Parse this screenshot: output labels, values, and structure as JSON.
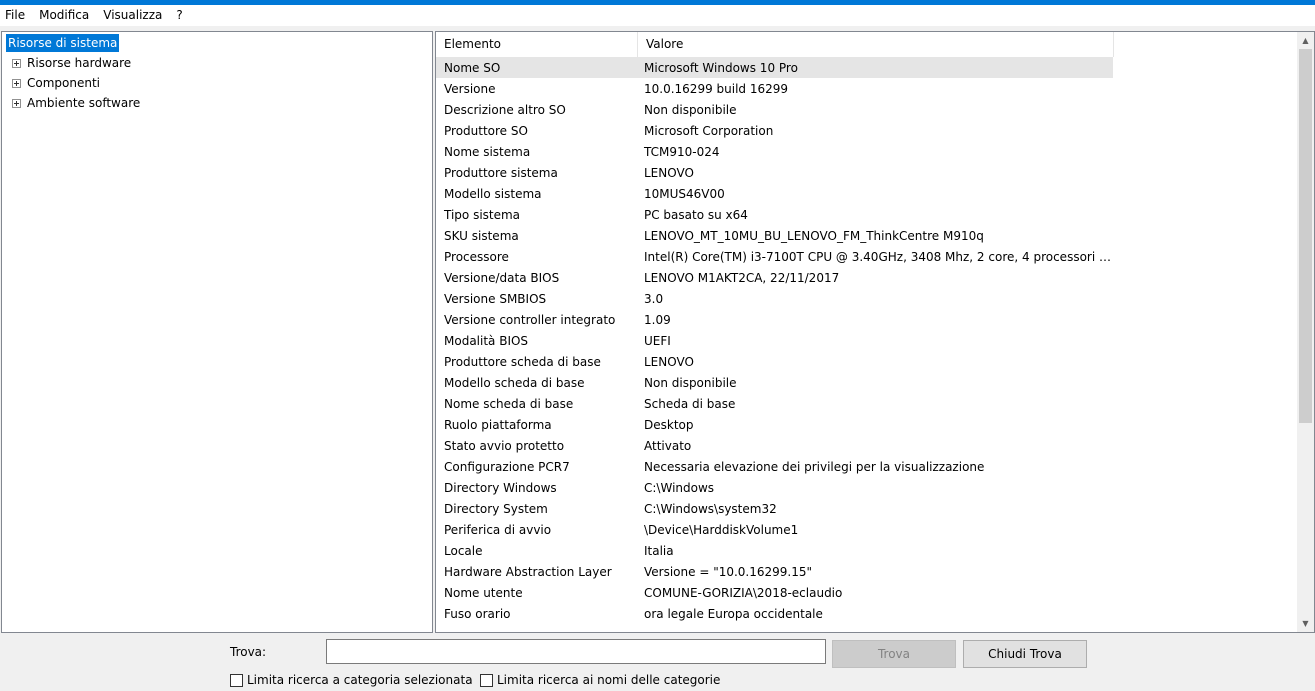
{
  "menu": [
    "File",
    "Modifica",
    "Visualizza",
    "?"
  ],
  "tree": {
    "root": "Risorse di sistema",
    "children": [
      "Risorse hardware",
      "Componenti",
      "Ambiente software"
    ]
  },
  "table": {
    "headers": [
      "Elemento",
      "Valore"
    ],
    "rows": [
      [
        "Nome SO",
        "Microsoft Windows 10 Pro"
      ],
      [
        "Versione",
        "10.0.16299 build 16299"
      ],
      [
        "Descrizione altro SO",
        "Non disponibile"
      ],
      [
        "Produttore SO",
        "Microsoft Corporation"
      ],
      [
        "Nome sistema",
        "TCM910-024"
      ],
      [
        "Produttore sistema",
        "LENOVO"
      ],
      [
        "Modello sistema",
        "10MUS46V00"
      ],
      [
        "Tipo sistema",
        "PC basato su x64"
      ],
      [
        "SKU sistema",
        "LENOVO_MT_10MU_BU_LENOVO_FM_ThinkCentre M910q"
      ],
      [
        "Processore",
        "Intel(R) Core(TM) i3-7100T CPU @ 3.40GHz, 3408 Mhz, 2 core, 4 processori lo..."
      ],
      [
        "Versione/data BIOS",
        "LENOVO M1AKT2CA, 22/11/2017"
      ],
      [
        "Versione SMBIOS",
        "3.0"
      ],
      [
        "Versione controller integrato",
        "1.09"
      ],
      [
        "Modalità BIOS",
        "UEFI"
      ],
      [
        "Produttore scheda di base",
        "LENOVO"
      ],
      [
        "Modello scheda di base",
        "Non disponibile"
      ],
      [
        "Nome scheda di base",
        "Scheda di base"
      ],
      [
        "Ruolo piattaforma",
        "Desktop"
      ],
      [
        "Stato avvio protetto",
        "Attivato"
      ],
      [
        "Configurazione PCR7",
        "Necessaria elevazione dei privilegi per la visualizzazione"
      ],
      [
        "Directory Windows",
        "C:\\Windows"
      ],
      [
        "Directory System",
        "C:\\Windows\\system32"
      ],
      [
        "Periferica di avvio",
        "\\Device\\HarddiskVolume1"
      ],
      [
        "Locale",
        "Italia"
      ],
      [
        "Hardware Abstraction Layer",
        "Versione = \"10.0.16299.15\""
      ],
      [
        "Nome utente",
        "COMUNE-GORIZIA\\2018-eclaudio"
      ],
      [
        "Fuso orario",
        "ora legale Europa occidentale"
      ]
    ]
  },
  "find": {
    "label": "Trova:",
    "value": "",
    "find_button": "Trova",
    "close_button": "Chiudi Trova",
    "option_selected_category": "Limita ricerca a categoria selezionata",
    "option_category_names": "Limita ricerca ai nomi delle categorie"
  },
  "colors": {
    "accent": "#0078d7",
    "selected_row": "#e5e5e5"
  }
}
